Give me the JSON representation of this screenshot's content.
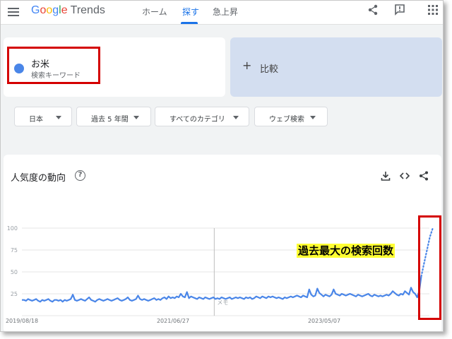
{
  "header": {
    "logo_google": [
      "G",
      "o",
      "o",
      "g",
      "l",
      "e"
    ],
    "logo_trends": "Trends",
    "nav": {
      "home": "ホーム",
      "explore": "探す",
      "rising": "急上昇"
    },
    "icons": [
      "menu-icon",
      "share-icon",
      "feedback-icon",
      "apps-icon"
    ]
  },
  "term": {
    "name": "お米",
    "subtitle": "検索キーワード",
    "color": "#4a86e8"
  },
  "compare": {
    "plus": "+",
    "label": "比較"
  },
  "filters": {
    "country": "日本",
    "period": "過去 5 年間",
    "category": "すべてのカテゴリ",
    "search_type": "ウェブ検索"
  },
  "trend": {
    "title": "人気度の動向",
    "help": "?",
    "icons": [
      "download-icon",
      "embed-icon",
      "share-icon"
    ]
  },
  "annotation": {
    "text": "過去最大の検索回数",
    "background": "#ffff33",
    "border_color": "#d40000"
  },
  "chart_data": {
    "type": "line",
    "y_ticks": [
      "100",
      "75",
      "50",
      "25"
    ],
    "ylim": [
      0,
      100
    ],
    "x_tick_labels": [
      "2019/08/18",
      "2021/06/27",
      "2023/05/07"
    ],
    "divider_note": "メモ",
    "grid": true,
    "series": [
      {
        "color": "#4a86e8",
        "values": [
          18,
          18,
          17,
          19,
          18,
          17,
          18,
          19,
          17,
          16,
          18,
          17,
          18,
          19,
          17,
          16,
          18,
          18,
          17,
          18,
          16,
          18,
          17,
          18,
          19,
          24,
          18,
          17,
          18,
          19,
          18,
          17,
          19,
          21,
          18,
          17,
          16,
          18,
          19,
          18,
          17,
          18,
          19,
          18,
          17,
          18,
          19,
          20,
          18,
          17,
          18,
          19,
          21,
          18,
          17,
          18,
          19,
          23,
          19,
          18,
          19,
          18,
          17,
          18,
          19,
          20,
          18,
          19,
          18,
          20,
          21,
          19,
          22,
          20,
          21,
          20,
          22,
          21,
          25,
          22,
          21,
          27,
          20,
          22,
          21,
          20,
          19,
          21,
          20,
          19,
          21,
          20,
          19,
          20,
          21,
          19,
          20,
          19,
          21,
          20,
          19,
          20,
          21,
          19,
          20,
          21,
          20,
          21,
          20,
          19,
          21,
          20,
          21,
          19,
          20,
          22,
          21,
          20,
          22,
          21,
          20,
          22,
          21,
          22,
          21,
          20,
          21,
          20,
          19,
          21,
          20,
          21,
          22,
          21,
          22,
          23,
          22,
          21,
          23,
          22,
          21,
          30,
          24,
          22,
          23,
          31,
          26,
          24,
          22,
          24,
          23,
          22,
          24,
          30,
          25,
          24,
          23,
          25,
          24,
          23,
          24,
          25,
          24,
          23,
          22,
          24,
          23,
          22,
          23,
          24,
          25,
          23,
          22,
          24,
          23,
          22,
          23,
          22,
          23,
          24,
          23,
          25,
          28,
          26,
          24,
          23,
          25,
          24,
          28,
          26,
          24,
          32,
          27,
          25,
          21,
          28,
          45
        ]
      },
      {
        "style": "dotted",
        "color": "#4a86e8",
        "values": [
          45,
          60,
          75,
          90,
          100
        ]
      }
    ]
  }
}
